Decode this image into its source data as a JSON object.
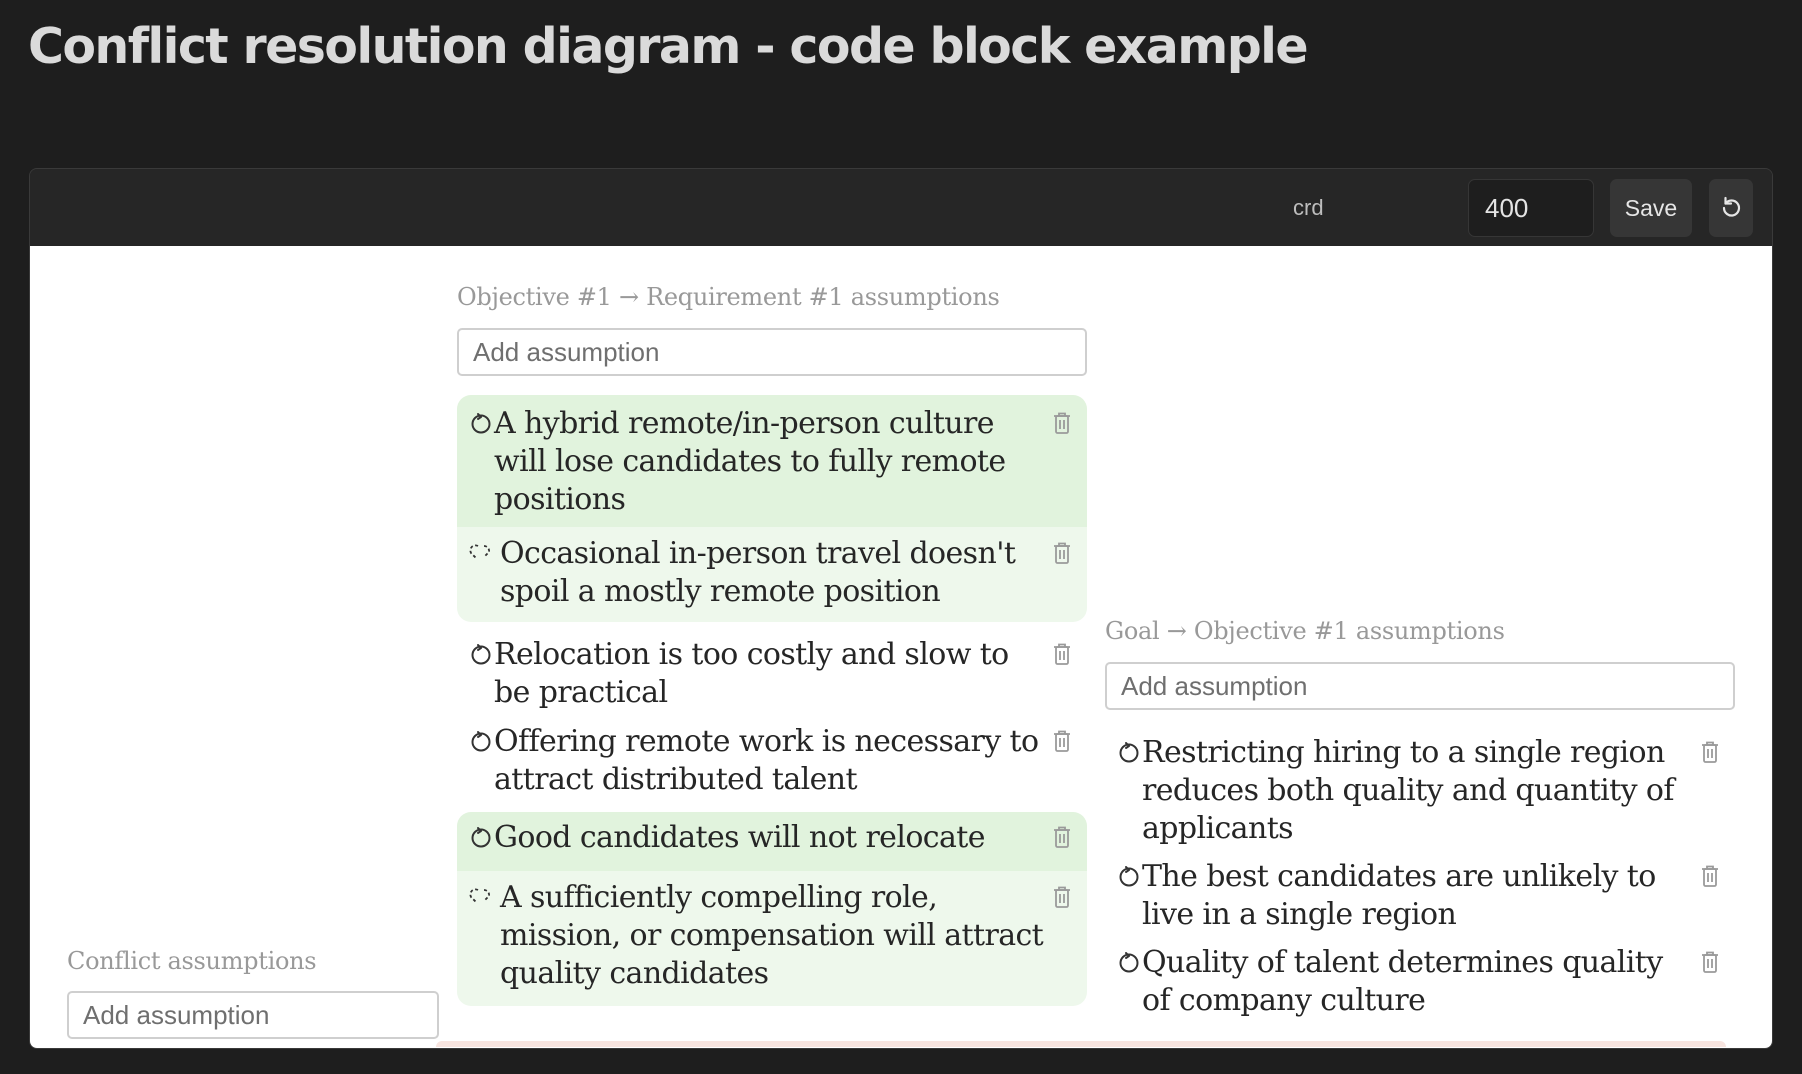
{
  "page_title": "Conflict resolution diagram - code block example",
  "toolbar": {
    "language": "crd",
    "height_value": "400",
    "save_label": "Save",
    "reset_icon": "reset-icon"
  },
  "colors": {
    "page_bg": "#1e1e1e",
    "toolbar_bg": "#262626",
    "highlight": "#e1f3dd",
    "highlight_light": "#eef8ec",
    "conflict_accent": "#f7e4df"
  },
  "requirement_section": {
    "label": "Objective #1 → Requirement #1 assumptions",
    "placeholder": "Add assumption",
    "items": [
      {
        "text": "A hybrid remote/in-person culture will lose candidates to fully remote positions",
        "icon": "assumption-icon",
        "state": "highlighted"
      },
      {
        "text": "Occasional in-person travel doesn't spoil a mostly remote position",
        "icon": "broken-link-icon",
        "state": "injection"
      },
      {
        "text": "Relocation is too costly and slow to be practical",
        "icon": "assumption-icon",
        "state": "normal"
      },
      {
        "text": "Offering remote work is necessary to attract distributed talent",
        "icon": "assumption-icon",
        "state": "normal"
      },
      {
        "text": "Good candidates will not relocate",
        "icon": "assumption-icon",
        "state": "highlighted"
      },
      {
        "text": "A sufficiently compelling role, mission, or compensation will attract quality candidates",
        "icon": "broken-link-icon",
        "state": "injection"
      }
    ]
  },
  "goal_section": {
    "label": "Goal → Objective #1 assumptions",
    "placeholder": "Add assumption",
    "items": [
      {
        "text": "Restricting hiring to a single region reduces both quality and quantity of applicants",
        "icon": "assumption-icon"
      },
      {
        "text": "The best candidates are unlikely to live in a single region",
        "icon": "assumption-icon"
      },
      {
        "text": "Quality of talent determines quality of company culture",
        "icon": "assumption-icon"
      }
    ]
  },
  "conflict_section": {
    "label": "Conflict assumptions",
    "placeholder": "Add assumption"
  }
}
